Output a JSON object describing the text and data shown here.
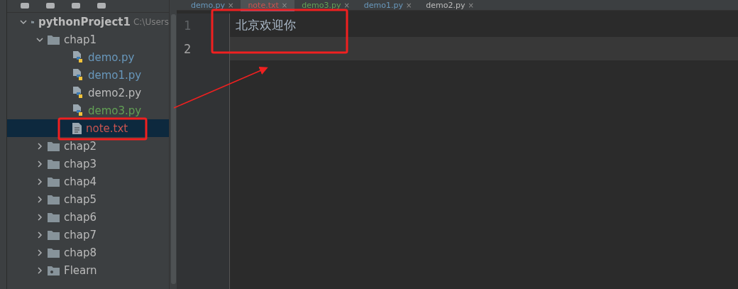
{
  "tabs": [
    {
      "label": "demo.py",
      "close": "×",
      "color": "#6897bb",
      "selected": false
    },
    {
      "label": "note.txt",
      "close": "×",
      "color": "#c75450",
      "selected": true
    },
    {
      "label": "demo3.py",
      "close": "×",
      "color": "#62a055",
      "selected": false
    },
    {
      "label": "demo1.py",
      "close": "×",
      "color": "#6897bb",
      "selected": false
    },
    {
      "label": "demo2.py",
      "close": "×",
      "color": "#bbbbbb",
      "selected": false
    }
  ],
  "tree": [
    {
      "kind": "project",
      "label": "pythonProject1",
      "path": "C:\\Users",
      "expanded": true,
      "children": [
        {
          "kind": "folder",
          "label": "chap1",
          "expanded": true,
          "children": [
            {
              "kind": "python",
              "label": "demo.py",
              "color": "#6897bb",
              "selected": false
            },
            {
              "kind": "python",
              "label": "demo1.py",
              "color": "#6897bb",
              "selected": false
            },
            {
              "kind": "python",
              "label": "demo2.py",
              "color": "#bbbbbb",
              "selected": false
            },
            {
              "kind": "python",
              "label": "demo3.py",
              "color": "#62a055",
              "selected": false
            },
            {
              "kind": "text",
              "label": "note.txt",
              "color": "#c75450",
              "selected": true
            }
          ]
        },
        {
          "kind": "folder",
          "label": "chap2",
          "expanded": false
        },
        {
          "kind": "folder",
          "label": "chap3",
          "expanded": false
        },
        {
          "kind": "folder",
          "label": "chap4",
          "expanded": false
        },
        {
          "kind": "folder",
          "label": "chap5",
          "expanded": false
        },
        {
          "kind": "folder",
          "label": "chap6",
          "expanded": false
        },
        {
          "kind": "folder",
          "label": "chap7",
          "expanded": false
        },
        {
          "kind": "folder",
          "label": "chap8",
          "expanded": false
        },
        {
          "kind": "module",
          "label": "Flearn",
          "expanded": false
        }
      ]
    }
  ],
  "editor": {
    "lines": [
      {
        "number": "1",
        "text": "北京欢迎你",
        "current": false
      },
      {
        "number": "2",
        "current": true
      }
    ]
  }
}
